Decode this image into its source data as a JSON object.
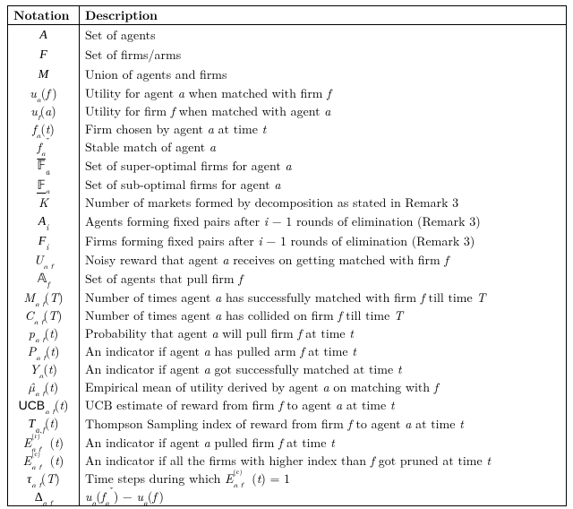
{
  "table": {
    "header": {
      "notation": "Notation",
      "description": "Description"
    },
    "rows": [
      {
        "n": "<span class='cal'>A</span>",
        "d": "Set of agents"
      },
      {
        "n": "<span class='cal'>F</span>",
        "d": "Set of firms/arms"
      },
      {
        "n": "<span class='cal'>M</span>",
        "d": "Union of agents and firms"
      },
      {
        "n": "<span class='it'>u<sub>a</sub></span>(<span class='it'>f</span>&#8201;)",
        "d": "Utility for agent <span class='it'>a</span> when matched with firm <span class='it'>f</span>"
      },
      {
        "n": "<span class='it'>u<sub>f</sub></span>(<span class='it'>a</span>)",
        "d": "Utility for firm <span class='it'>f</span> when matched with agent <span class='it'>a</span>"
      },
      {
        "n": "<span class='it'>f<sub>a</sub></span>(<span class='it'>t</span>)",
        "d": "Firm chosen by agent <span class='it'>a</span> at time <span class='it'>t</span>"
      },
      {
        "n": "<span class='it'>f</span><span class='it'><sub>a</sub></span><sup>*</sup>",
        "d": "Stable match of agent <span class='it'>a</span>"
      },
      {
        "n": "<span style='text-decoration: overline;'><span class='bb'>&#120125;</span></span><sub class='it'>a</sub>",
        "d": "Set of super-optimal firms for agent <span class='it'>a</span>"
      },
      {
        "n": "<span style='border-bottom:1px solid #000; display:inline-block; line-height:0.9em;'><span class='bb'>&#120125;</span></span><sub class='it'>a</sub>",
        "d": "Set of sub-optimal firms for agent <span class='it'>a</span>"
      },
      {
        "n": "<span class='it'>K</span>",
        "d": "Number of markets formed by decomposition as stated in Remark 3"
      },
      {
        "n": "<span class='cal'>A</span><sub class='it'>i</sub>",
        "d": "Agents forming fixed pairs after <span class='it'>i</span> − 1 rounds of elimination (Remark 3)"
      },
      {
        "n": "<span class='cal'>F</span><sub class='it'>i</sub>",
        "d": "Firms forming fixed pairs after <span class='it'>i</span> − 1 rounds of elimination (Remark 3)"
      },
      {
        "n": "<span class='it'>U<sub>a,f</sub></span>",
        "d": "Noisy reward that agent <span class='it'>a</span> receives on getting matched with firm <span class='it'>f</span>"
      },
      {
        "n": "<span class='bb'>&#120120;</span><sub class='it'>f</sub>",
        "d": "Set of agents that pull firm <span class='it'>f</span>"
      },
      {
        "n": "<span class='it'>M<sub>a,f</sub></span>(<span class='it'>T</span>)",
        "d": "Number of times agent <span class='it'>a</span> has successfully matched with firm <span class='it'>f</span> till time <span class='it'>T</span>"
      },
      {
        "n": "<span class='it'>C<sub>a,f</sub></span>(<span class='it'>T</span>)",
        "d": "Number of times agent <span class='it'>a</span> has collided on firm <span class='it'>f</span> till time <span class='it'>T</span>"
      },
      {
        "n": "<span class='it'>p<sub>a,f</sub></span>(<span class='it'>t</span>)",
        "d": "Probability that agent <span class='it'>a</span> will pull firm <span class='it'>f</span> at time <span class='it'>t</span>"
      },
      {
        "n": "<span class='it'>P<sub>a,f</sub></span>(<span class='it'>t</span>)",
        "d": "An indicator if agent <span class='it'>a</span> has pulled arm <span class='it'>f</span> at time <span class='it'>t</span>"
      },
      {
        "n": "<span class='it'>Y<sub>a</sub></span>(<span class='it'>t</span>)",
        "d": "An indicator if agent <span class='it'>a</span> got successfully matched at time <span class='it'>t</span>"
      },
      {
        "n": "<span class='it'>µ̂<sub>a,f</sub></span>(<span class='it'>t</span>)",
        "d": "Empirical mean of utility derived by agent <span class='it'>a</span> on matching with <span class='it'>f</span>"
      },
      {
        "n": "<span class='sf'>UCB</span><sub class='it'>a,f</sub>(<span class='it'>t</span>)",
        "d": "UCB estimate of reward from firm <span class='it'>f</span> to agent <span class='it'>a</span> at time <span class='it'>t</span>"
      },
      {
        "n": "<span class='cal'>T</span><sub class='it'>a,f</sub>(<span class='it'>t</span>)",
        "d": "Thompson Sampling index of reward from firm <span class='it'>f</span> to agent <span class='it'>a</span> at time <span class='it'>t</span>"
      },
      {
        "n": "<span class='it'>E</span><sup><span class='ssub'>(r)</span></sup><sub class='it' style='position:relative; left:-10px;'>a,f</sub>(<span class='it'>t</span>)",
        "d": "An indicator if agent <span class='it'>a</span> pulled firm <span class='it'>f</span> at time <span class='it'>t</span>"
      },
      {
        "n": "<span class='it'>E</span><sup><span class='ssub'>(c)</span></sup><sub class='it' style='position:relative; left:-10px;'>a,f</sub>(<span class='it'>t</span>)",
        "d": "An indicator if all the firms with higher index than <span class='it'>f</span> got pruned at time <span class='it'>t</span>"
      },
      {
        "n": "<span class='it'>τ<sub>a,f</sub></span>(<span class='it'>T</span>)",
        "d": "Time steps during which <span class='it'>E</span><sup><span class='ssub'>(c)</span></sup><sub class='it' style='position:relative; left:-10px;'>a,f</sub>(<span class='it'>t</span>) = 1"
      },
      {
        "n": "∆<sub class='it'>a,f</sub>",
        "d": "<span class='it'>u<sub>a</sub></span>(<span class='it'>f</span><sub class='it'>a</sub><sup>*</sup>) − <span class='it'>u<sub>a</sub></span>(<span class='it'>f</span>&#8201;)"
      }
    ]
  }
}
